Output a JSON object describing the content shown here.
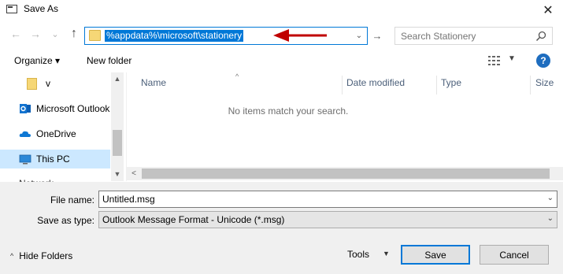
{
  "window": {
    "title": "Save As",
    "close_label": "✕"
  },
  "address_bar": {
    "path": "%appdata%\\microsoft\\stationery",
    "back_glyph": "←",
    "forward_glyph": "→",
    "recent_glyph": "⌄",
    "up_glyph": "↑",
    "dropdown_glyph": "⌄",
    "go_glyph": "→"
  },
  "search": {
    "placeholder": "Search Stationery"
  },
  "toolbar": {
    "organize_label": "Organize ▾",
    "new_folder_label": "New folder",
    "view_dropdown_glyph": "▼",
    "help_label": "?"
  },
  "nav_pane": {
    "items": [
      {
        "label": "v"
      },
      {
        "label": "Microsoft Outlook"
      },
      {
        "label": "OneDrive"
      },
      {
        "label": "This PC"
      }
    ],
    "cutoff_label": "Network"
  },
  "file_list": {
    "columns": [
      "Name",
      "Date modified",
      "Type",
      "Size"
    ],
    "sort_glyph": "^",
    "empty_message": "No items match your search.",
    "scroll_left_glyph": "<"
  },
  "form": {
    "file_name_label": "File name:",
    "file_name_value": "Untitled.msg",
    "save_type_label": "Save as type:",
    "save_type_value": "Outlook Message Format - Unicode (*.msg)",
    "dropdown_glyph": "⌄"
  },
  "footer": {
    "hide_folders_label": "Hide Folders",
    "hide_folders_glyph": "^",
    "tools_label": "Tools",
    "tools_glyph": "▼",
    "save_label": "Save",
    "cancel_label": "Cancel"
  },
  "colors": {
    "accent": "#0078d7",
    "annotation_arrow": "#c00000",
    "selection": "#cce8ff",
    "folder": "#f6d776"
  }
}
